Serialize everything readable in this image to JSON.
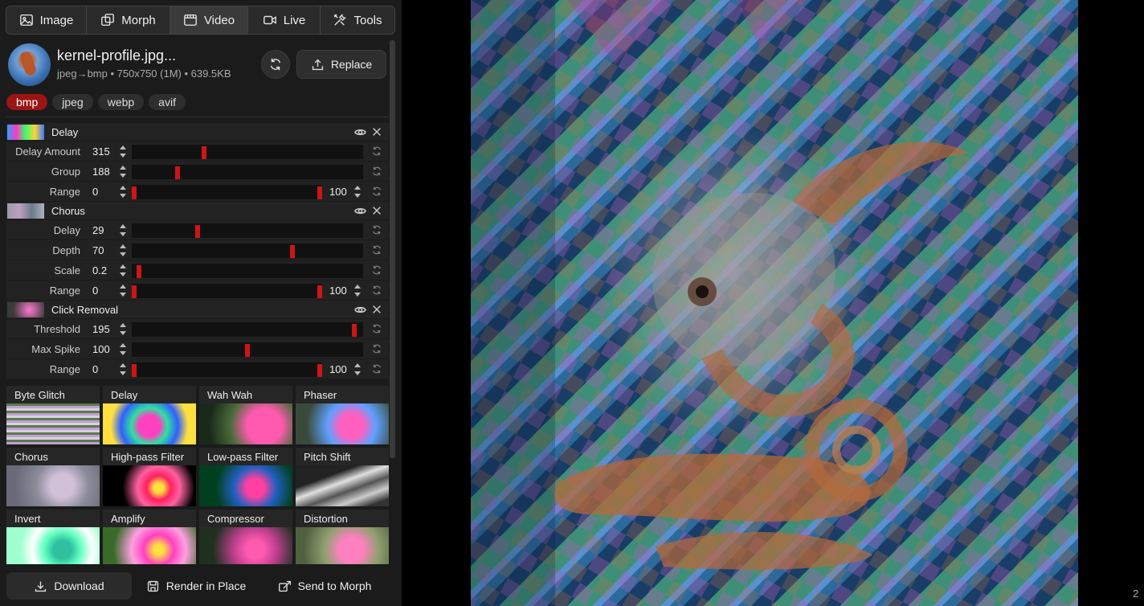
{
  "tabs": [
    {
      "label": "Image",
      "icon": "image-icon",
      "active": false
    },
    {
      "label": "Morph",
      "icon": "morph-icon",
      "active": false
    },
    {
      "label": "Video",
      "icon": "video-icon",
      "active": true
    },
    {
      "label": "Live",
      "icon": "camera-icon",
      "active": false
    },
    {
      "label": "Tools",
      "icon": "tools-icon",
      "active": false
    }
  ],
  "file": {
    "name": "kernel-profile.jpg...",
    "meta": "jpeg→bmp • 750x750 (1M) • 639.5KB",
    "replace_label": "Replace"
  },
  "formats": [
    "bmp",
    "jpeg",
    "webp",
    "avif"
  ],
  "active_format": "bmp",
  "effects": [
    {
      "title": "Delay",
      "params": [
        {
          "label": "Delay Amount",
          "value": "315",
          "fraction": 0.31
        },
        {
          "label": "Group",
          "value": "188",
          "fraction": 0.19
        },
        {
          "label": "Range",
          "value": "0",
          "value2": "100",
          "range": true
        }
      ]
    },
    {
      "title": "Chorus",
      "params": [
        {
          "label": "Delay",
          "value": "29",
          "fraction": 0.28
        },
        {
          "label": "Depth",
          "value": "70",
          "fraction": 0.7
        },
        {
          "label": "Scale",
          "value": "0.2",
          "fraction": 0.02
        },
        {
          "label": "Range",
          "value": "0",
          "value2": "100",
          "range": true
        }
      ]
    },
    {
      "title": "Click Removal",
      "params": [
        {
          "label": "Threshold",
          "value": "195",
          "fraction": 0.97
        },
        {
          "label": "Max Spike",
          "value": "100",
          "fraction": 0.5
        },
        {
          "label": "Range",
          "value": "0",
          "value2": "100",
          "range": true
        }
      ]
    }
  ],
  "effect_library": [
    "Byte Glitch",
    "Delay",
    "Wah Wah",
    "Phaser",
    "Chorus",
    "High-pass Filter",
    "Low-pass Filter",
    "Pitch Shift",
    "Invert",
    "Amplify",
    "Compressor",
    "Distortion"
  ],
  "actions": {
    "download": "Download",
    "render": "Render in Place",
    "send": "Send to Morph"
  },
  "page_number": "2",
  "colors": {
    "accent": "#cc1515",
    "format_active": "#9b1515",
    "panel_bg": "#1b1b1b"
  }
}
